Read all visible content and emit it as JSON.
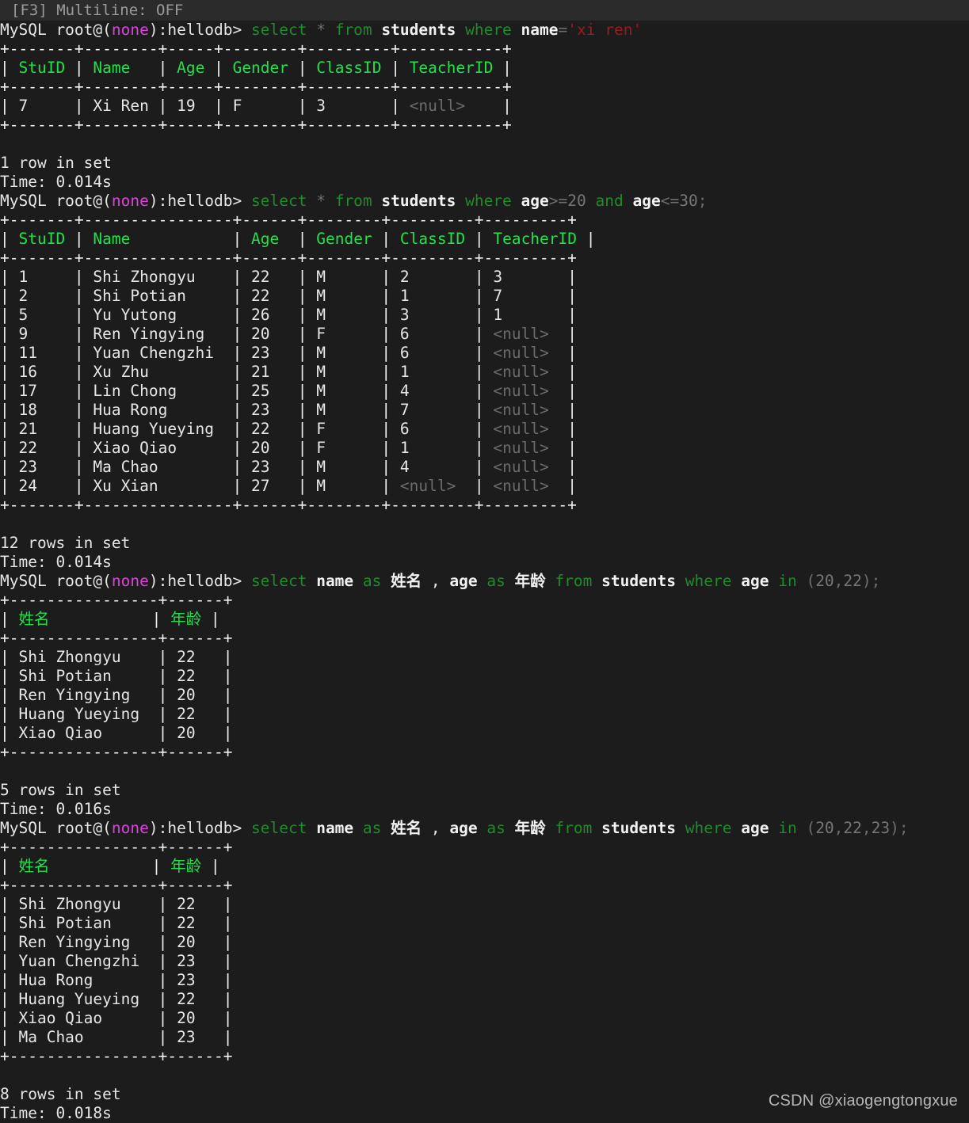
{
  "status_bar": {
    "text": "[F3] Multiline: OFF",
    "key_hint": "[F3]",
    "label": "Multiline:",
    "value": "OFF"
  },
  "prompt": {
    "user_host": "MySQL root@(",
    "db_none": "none",
    "suffix": "):hellodb> "
  },
  "blocks": [
    {
      "id": "query-1",
      "query_tokens": [
        {
          "t": "select",
          "c": "kw"
        },
        {
          "t": " ",
          "c": "w"
        },
        {
          "t": "*",
          "c": "op"
        },
        {
          "t": " ",
          "c": "w"
        },
        {
          "t": "from",
          "c": "kw"
        },
        {
          "t": " ",
          "c": "w"
        },
        {
          "t": "students",
          "c": "wb"
        },
        {
          "t": " ",
          "c": "w"
        },
        {
          "t": "where",
          "c": "kw"
        },
        {
          "t": " ",
          "c": "w"
        },
        {
          "t": "name",
          "c": "wb"
        },
        {
          "t": "=",
          "c": "op"
        },
        {
          "t": "'xi ren'",
          "c": "str"
        }
      ],
      "columns": [
        "StuID",
        "Name",
        "Age",
        "Gender",
        "ClassID",
        "TeacherID"
      ],
      "widths": [
        7,
        8,
        5,
        8,
        9,
        11
      ],
      "rows": [
        [
          "7",
          "Xi Ren",
          "19",
          "F",
          "3",
          "<null>"
        ]
      ],
      "result_count": "1 row in set",
      "result_time": "Time: 0.014s"
    },
    {
      "id": "query-2",
      "query_tokens": [
        {
          "t": "select",
          "c": "kw"
        },
        {
          "t": " ",
          "c": "w"
        },
        {
          "t": "*",
          "c": "op"
        },
        {
          "t": " ",
          "c": "w"
        },
        {
          "t": "from",
          "c": "kw"
        },
        {
          "t": " ",
          "c": "w"
        },
        {
          "t": "students",
          "c": "wb"
        },
        {
          "t": " ",
          "c": "w"
        },
        {
          "t": "where",
          "c": "kw"
        },
        {
          "t": " ",
          "c": "w"
        },
        {
          "t": "age",
          "c": "wb"
        },
        {
          "t": ">=",
          "c": "op"
        },
        {
          "t": "20",
          "c": "num"
        },
        {
          "t": " ",
          "c": "w"
        },
        {
          "t": "and",
          "c": "kw"
        },
        {
          "t": " ",
          "c": "w"
        },
        {
          "t": "age",
          "c": "wb"
        },
        {
          "t": "<=",
          "c": "op"
        },
        {
          "t": "30",
          "c": "num"
        },
        {
          "t": ";",
          "c": "op"
        }
      ],
      "columns": [
        "StuID",
        "Name",
        "Age",
        "Gender",
        "ClassID",
        "TeacherID"
      ],
      "widths": [
        7,
        16,
        6,
        8,
        9,
        9
      ],
      "rows": [
        [
          "1",
          "Shi Zhongyu",
          "22",
          "M",
          "2",
          "3"
        ],
        [
          "2",
          "Shi Potian",
          "22",
          "M",
          "1",
          "7"
        ],
        [
          "5",
          "Yu Yutong",
          "26",
          "M",
          "3",
          "1"
        ],
        [
          "9",
          "Ren Yingying",
          "20",
          "F",
          "6",
          "<null>"
        ],
        [
          "11",
          "Yuan Chengzhi",
          "23",
          "M",
          "6",
          "<null>"
        ],
        [
          "16",
          "Xu Zhu",
          "21",
          "M",
          "1",
          "<null>"
        ],
        [
          "17",
          "Lin Chong",
          "25",
          "M",
          "4",
          "<null>"
        ],
        [
          "18",
          "Hua Rong",
          "23",
          "M",
          "7",
          "<null>"
        ],
        [
          "21",
          "Huang Yueying",
          "22",
          "F",
          "6",
          "<null>"
        ],
        [
          "22",
          "Xiao Qiao",
          "20",
          "F",
          "1",
          "<null>"
        ],
        [
          "23",
          "Ma Chao",
          "23",
          "M",
          "4",
          "<null>"
        ],
        [
          "24",
          "Xu Xian",
          "27",
          "M",
          "<null>",
          "<null>"
        ]
      ],
      "result_count": "12 rows in set",
      "result_time": "Time: 0.014s"
    },
    {
      "id": "query-3",
      "query_tokens": [
        {
          "t": "select",
          "c": "kw"
        },
        {
          "t": " ",
          "c": "w"
        },
        {
          "t": "name",
          "c": "wb"
        },
        {
          "t": " ",
          "c": "w"
        },
        {
          "t": "as",
          "c": "kw"
        },
        {
          "t": " ",
          "c": "w"
        },
        {
          "t": "姓名",
          "c": "wb"
        },
        {
          "t": " , ",
          "c": "w"
        },
        {
          "t": "age",
          "c": "wb"
        },
        {
          "t": " ",
          "c": "w"
        },
        {
          "t": "as",
          "c": "kw"
        },
        {
          "t": " ",
          "c": "w"
        },
        {
          "t": "年龄",
          "c": "wb"
        },
        {
          "t": " ",
          "c": "w"
        },
        {
          "t": "from",
          "c": "kw"
        },
        {
          "t": " ",
          "c": "w"
        },
        {
          "t": "students",
          "c": "wb"
        },
        {
          "t": " ",
          "c": "w"
        },
        {
          "t": "where",
          "c": "kw"
        },
        {
          "t": " ",
          "c": "w"
        },
        {
          "t": "age",
          "c": "wb"
        },
        {
          "t": " ",
          "c": "w"
        },
        {
          "t": "in",
          "c": "kw"
        },
        {
          "t": " (",
          "c": "op"
        },
        {
          "t": "20",
          "c": "num"
        },
        {
          "t": ",",
          "c": "op"
        },
        {
          "t": "22",
          "c": "num"
        },
        {
          "t": ");",
          "c": "op"
        }
      ],
      "columns": [
        "姓名",
        "年龄"
      ],
      "widths": [
        16,
        6
      ],
      "rows": [
        [
          "Shi Zhongyu",
          "22"
        ],
        [
          "Shi Potian",
          "22"
        ],
        [
          "Ren Yingying",
          "20"
        ],
        [
          "Huang Yueying",
          "22"
        ],
        [
          "Xiao Qiao",
          "20"
        ]
      ],
      "result_count": "5 rows in set",
      "result_time": "Time: 0.016s"
    },
    {
      "id": "query-4",
      "query_tokens": [
        {
          "t": "select",
          "c": "kw"
        },
        {
          "t": " ",
          "c": "w"
        },
        {
          "t": "name",
          "c": "wb"
        },
        {
          "t": " ",
          "c": "w"
        },
        {
          "t": "as",
          "c": "kw"
        },
        {
          "t": " ",
          "c": "w"
        },
        {
          "t": "姓名",
          "c": "wb"
        },
        {
          "t": " , ",
          "c": "w"
        },
        {
          "t": "age",
          "c": "wb"
        },
        {
          "t": " ",
          "c": "w"
        },
        {
          "t": "as",
          "c": "kw"
        },
        {
          "t": " ",
          "c": "w"
        },
        {
          "t": "年龄",
          "c": "wb"
        },
        {
          "t": " ",
          "c": "w"
        },
        {
          "t": "from",
          "c": "kw"
        },
        {
          "t": " ",
          "c": "w"
        },
        {
          "t": "students",
          "c": "wb"
        },
        {
          "t": " ",
          "c": "w"
        },
        {
          "t": "where",
          "c": "kw"
        },
        {
          "t": " ",
          "c": "w"
        },
        {
          "t": "age",
          "c": "wb"
        },
        {
          "t": " ",
          "c": "w"
        },
        {
          "t": "in",
          "c": "kw"
        },
        {
          "t": " (",
          "c": "op"
        },
        {
          "t": "20",
          "c": "num"
        },
        {
          "t": ",",
          "c": "op"
        },
        {
          "t": "22",
          "c": "num"
        },
        {
          "t": ",",
          "c": "op"
        },
        {
          "t": "23",
          "c": "num"
        },
        {
          "t": ");",
          "c": "op"
        }
      ],
      "columns": [
        "姓名",
        "年龄"
      ],
      "widths": [
        16,
        6
      ],
      "rows": [
        [
          "Shi Zhongyu",
          "22"
        ],
        [
          "Shi Potian",
          "22"
        ],
        [
          "Ren Yingying",
          "20"
        ],
        [
          "Yuan Chengzhi",
          "23"
        ],
        [
          "Hua Rong",
          "23"
        ],
        [
          "Huang Yueying",
          "22"
        ],
        [
          "Xiao Qiao",
          "20"
        ],
        [
          "Ma Chao",
          "23"
        ]
      ],
      "result_count": "8 rows in set",
      "result_time": "Time: 0.018s"
    }
  ],
  "watermark": "CSDN @xiaogengtongxue",
  "colors": {
    "background": "#1c1c1c",
    "statusbar_bg": "#2b2b2b",
    "keyword": "#1f8b2b",
    "header": "#22e04a",
    "string": "#9e1b1b",
    "magenta": "#e040e0",
    "null": "#6b6b6b",
    "text": "#e6e6e6"
  }
}
